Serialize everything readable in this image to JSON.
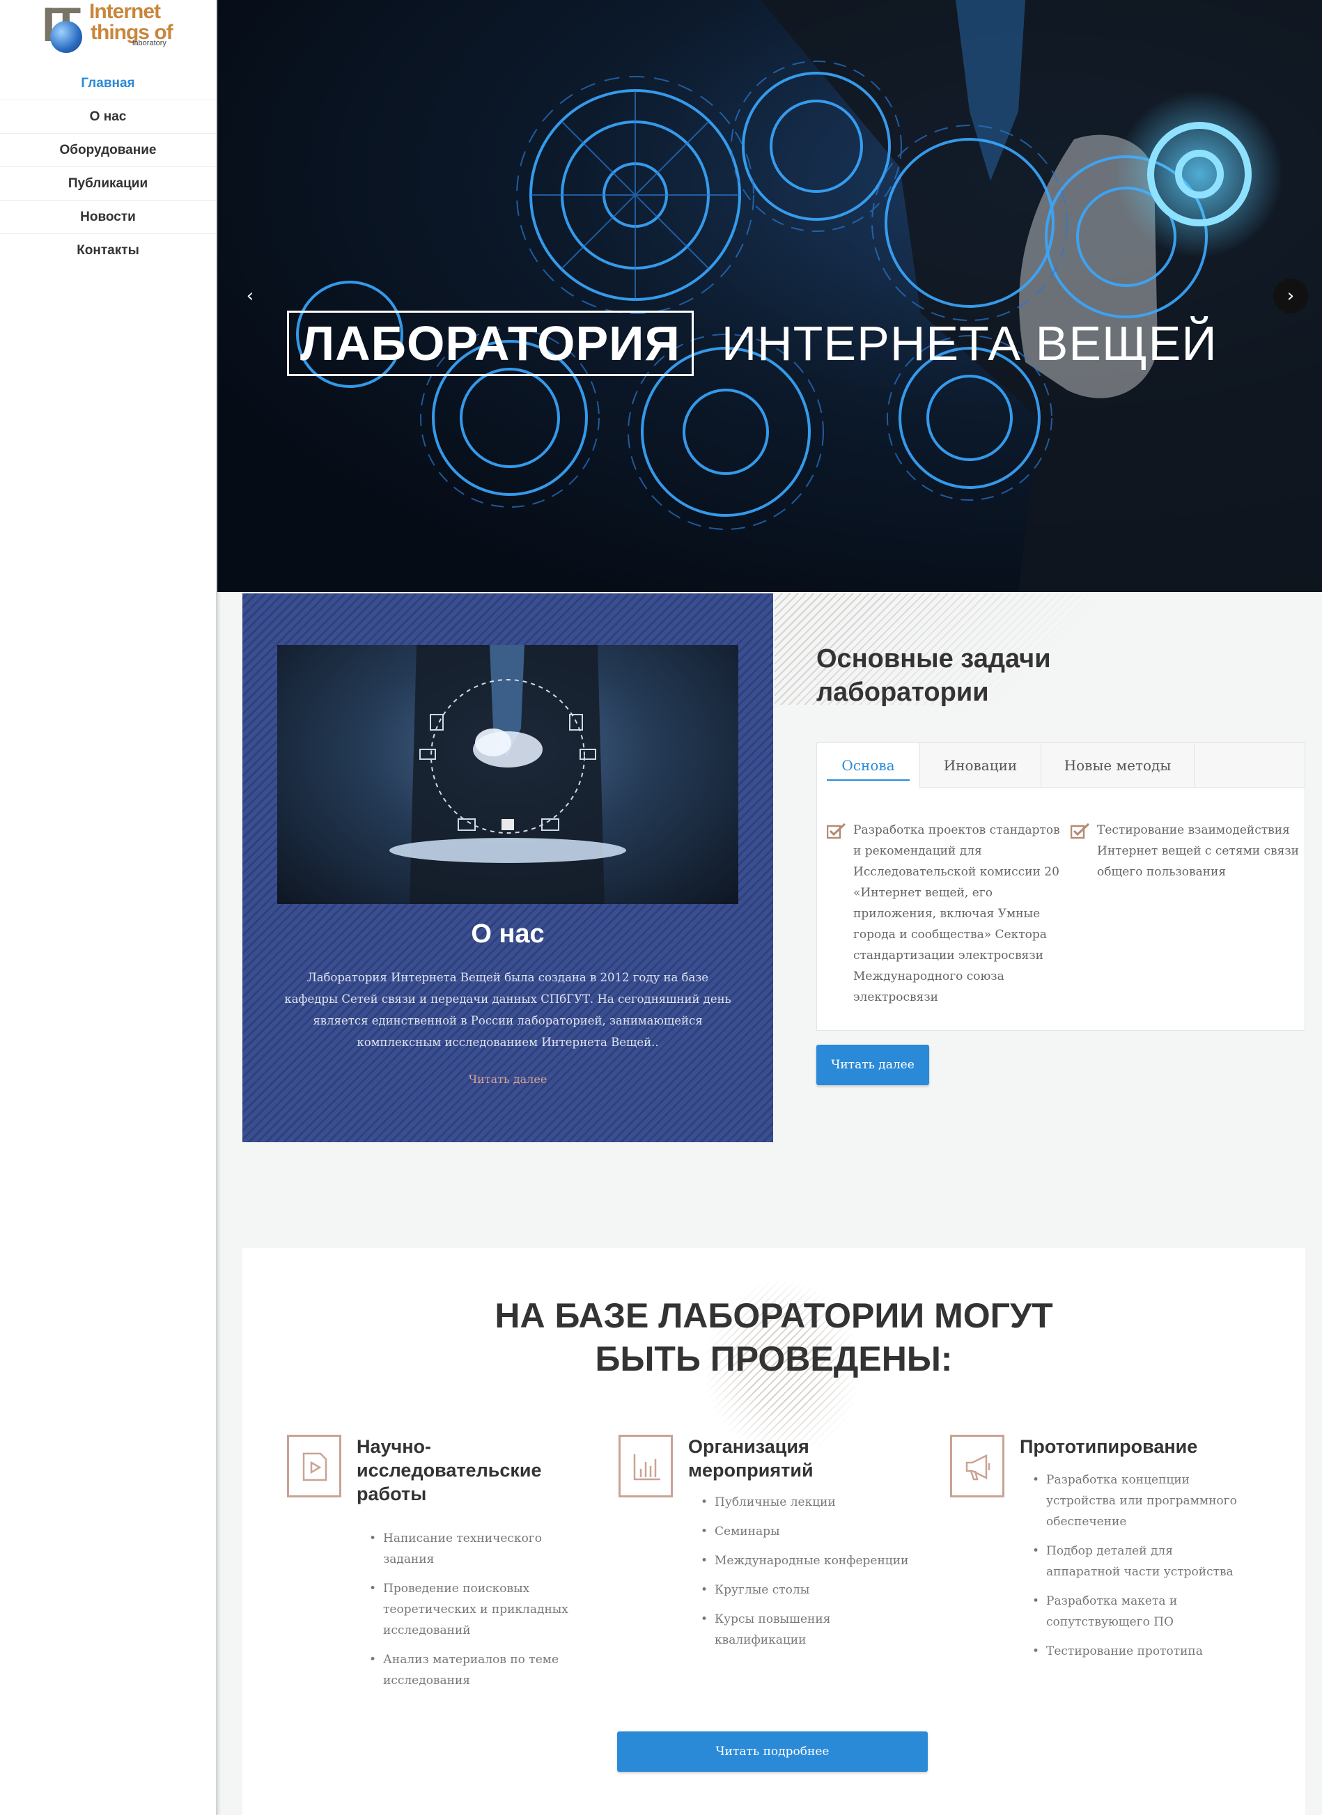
{
  "logo": {
    "big": "IT",
    "line1": "Internet",
    "line2": "things of",
    "line3": "laboratory"
  },
  "nav": [
    {
      "label": "Главная",
      "active": true
    },
    {
      "label": "О нас"
    },
    {
      "label": "Оборудование"
    },
    {
      "label": "Публикации"
    },
    {
      "label": "Новости"
    },
    {
      "label": "Контакты"
    }
  ],
  "hero": {
    "title_boxed": "ЛАБОРАТОРИЯ",
    "title_rest": "ИНТЕРНЕТА ВЕЩЕЙ",
    "prev_icon": "‹",
    "next_icon": "›"
  },
  "about": {
    "title": "О нас",
    "text": "Лаборатория Интернета Вещей была создана в 2012 году на базе кафедры Сетей связи и передачи данных СПбГУТ. На сегодняшний день является единственной в России лабораторией, занимающейся комплексным исследованием Интернета Вещей..",
    "link": "Читать далее"
  },
  "tasks": {
    "title": "Основные задачи лаборатории",
    "tabs": [
      "Основа",
      "Иновации",
      "Новые методы"
    ],
    "items": [
      "Разработка проектов стандартов и рекомендаций для Исследовательской комиссии 20 «Интернет вещей, его приложения, включая Умные города и сообщества» Сектора стандартизации электросвязи Международного союза электросвязи",
      "Тестирование взаимодействия Интернет вещей с сетями связи общего пользования"
    ],
    "button": "Читать далее"
  },
  "services": {
    "title_line1": "НА БАЗЕ ЛАБОРАТОРИИ МОГУТ",
    "title_line2": "БЫТЬ ПРОВЕДЕНЫ:",
    "columns": [
      {
        "icon": "video-file-icon",
        "heading": "Научно-исследовательские работы",
        "items": [
          "Написание технического задания",
          "Проведение поисковых теоретических и прикладных исследований",
          "Анализ материалов по теме исследования"
        ]
      },
      {
        "icon": "bar-chart-icon",
        "heading": "Организация мероприятий",
        "items": [
          "Публичные лекции",
          "Семинары",
          "Международные конференции",
          "Круглые столы",
          "Курсы повышения квалификации"
        ]
      },
      {
        "icon": "megaphone-icon",
        "heading": "Прототипирование",
        "items": [
          "Разработка концепции устройства или программного обеспечение",
          "Подбор деталей для аппаратной части устройства",
          "Разработка макета и сопутствующего ПО",
          "Тестирование прототипа"
        ]
      }
    ],
    "button": "Читать подробнее"
  },
  "colors": {
    "accent": "#2a8ad8",
    "about_bg": "#3a4f93",
    "icon_border": "#c9a394",
    "link_muted": "#d7a296"
  }
}
